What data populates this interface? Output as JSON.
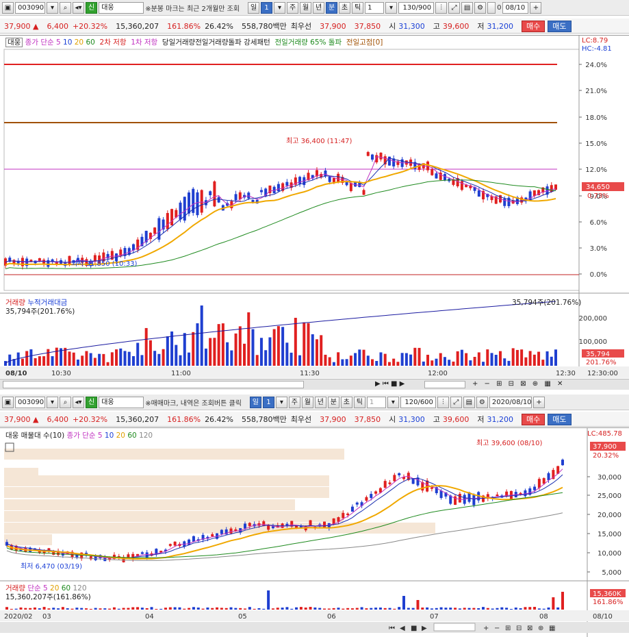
{
  "top": {
    "code": "003090",
    "name": "대웅",
    "sin_label": "신",
    "note": "※분봉 마크는 최근 2개월만 조회",
    "periods": [
      "일",
      "1",
      "주",
      "월",
      "년",
      "분",
      "초",
      "틱"
    ],
    "period_selected": "분",
    "interval": "1",
    "count": "130/900",
    "date": "08/10",
    "chk": "0"
  },
  "bottom": {
    "code": "003090",
    "name": "대웅",
    "sin_label": "신",
    "note": "※매매마크, 내역은 조회버튼 클릭",
    "periods": [
      "일",
      "1",
      "주",
      "월",
      "년",
      "분",
      "초",
      "틱"
    ],
    "period_selected": "일",
    "interval": "1",
    "count": "120/600",
    "date": "2020/08/10"
  },
  "price": {
    "last": "37,900 ▲",
    "change": "6,400",
    "rate": "+20.32%",
    "volume": "15,360,207",
    "vol_ratio": "161.86%",
    "turnover": "26.42%",
    "amount": "558,780백만",
    "best_label": "최우선",
    "ask": "37,900",
    "bid": "37,850",
    "open_label": "시",
    "open": "31,300",
    "high_label": "고",
    "high": "39,600",
    "low_label": "저",
    "low": "31,200",
    "buy": "매수",
    "sell": "매도"
  },
  "minute_chart": {
    "legend": {
      "tag": "대웅",
      "ma_label": "종가 단순",
      "ma": [
        "5",
        "10",
        "20",
        "60"
      ],
      "resist2": "2차 저항",
      "resist1": "1차 저항",
      "pattern": "당일거래량전일거래량돌파 강세패턴",
      "prev_vol": "전일거래량 65% 돌파",
      "prev_high": "전일고점[0]"
    },
    "lc": "LC:8.79",
    "hc": "HC:-4.81",
    "current_price": "34,650",
    "current_pct": "0.73%",
    "high_note": "최고 36,400 (11:47)",
    "low_note": "최저 31,850 (10:33)",
    "y_ticks": [
      "24.0%",
      "21.0%",
      "18.0%",
      "15.0%",
      "12.0%",
      "9.0%",
      "6.0%",
      "3.0%",
      "0.0%"
    ],
    "x_ticks": [
      "08/10",
      "10:30",
      "11:00",
      "11:30",
      "12:00",
      "12:30"
    ],
    "x_end": "12:30:00",
    "volume_legend": {
      "label": "거래량",
      "cum": "누적거래대금",
      "value": "35,794주(201.76%)"
    },
    "volume_right": "35,794주(201.76%)",
    "volume_ticks": [
      "200,000",
      "100,000"
    ],
    "volume_current": "35,794",
    "volume_pct": "201.76%"
  },
  "daily_chart": {
    "legend": {
      "label": "대웅 매물대 수(10)",
      "ma_label": "종가 단순",
      "ma": [
        "5",
        "10",
        "20",
        "60",
        "120"
      ]
    },
    "lc": "LC:485.78",
    "current_price": "37,900",
    "current_pct": "20.32%",
    "high_note": "최고 39,600 (08/10)",
    "low_note": "최저 6,470 (03/19)",
    "y_ticks": [
      "30,000",
      "25,000",
      "20,000",
      "15,000",
      "10,000",
      "5,000"
    ],
    "x_ticks": [
      "2020/02",
      "03",
      "04",
      "05",
      "06",
      "07",
      "08"
    ],
    "x_end": "08/10",
    "volume_legend": {
      "label": "거래량",
      "ma_label": "단순",
      "ma": [
        "5",
        "20",
        "60",
        "120"
      ],
      "value": "15,360,207주(161.86%)"
    },
    "volume_current": "15,360K",
    "volume_pct": "161.86%"
  },
  "colors": {
    "up": "#e02020",
    "down": "#1f3fd0",
    "ma5": "#c030c0",
    "ma10": "#1a2fb0",
    "ma20": "#f0a800",
    "ma60": "#1e8a1e",
    "ma120": "#888888"
  }
}
